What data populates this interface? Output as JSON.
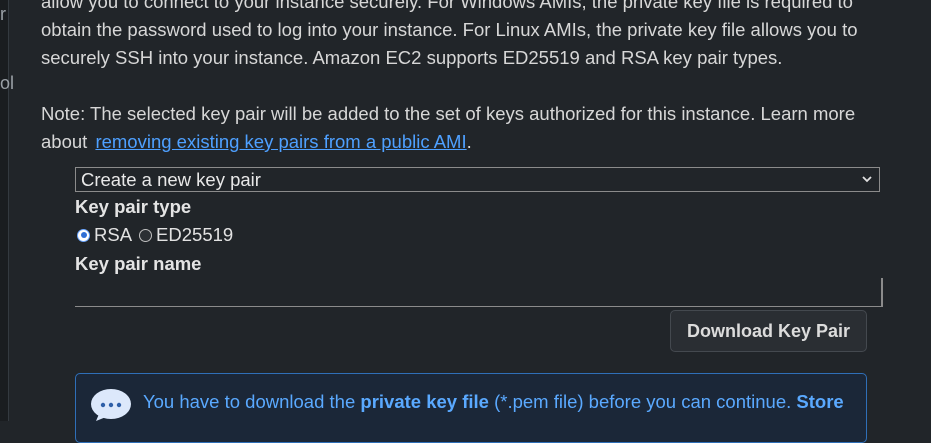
{
  "left_rail": {
    "fragments": [
      "r",
      "ol"
    ]
  },
  "intro": {
    "line1": "allow you to connect to your instance securely. For Windows AMIs, the private key file is required to",
    "line2": "obtain the password used to log into your instance. For Linux AMIs, the private key file allows you to",
    "line3": "securely SSH into your instance. Amazon EC2 supports ED25519 and RSA key pair types."
  },
  "note": {
    "line1": "Note: The selected key pair will be added to the set of keys authorized for this instance. Learn more",
    "prefix": "about",
    "link_text": "removing existing key pairs from a public AMI",
    "suffix": "."
  },
  "key_pair_select": {
    "value": "Create a new key pair",
    "chevron_icon": "chevron-down-icon"
  },
  "key_pair_type": {
    "label": "Key pair type",
    "options": [
      {
        "label": "RSA",
        "selected": true
      },
      {
        "label": "ED25519",
        "selected": false
      }
    ]
  },
  "key_pair_name": {
    "label": "Key pair name",
    "value": ""
  },
  "download_button": {
    "label": "Download Key Pair"
  },
  "alert": {
    "icon": "speech-bubble-dots-icon",
    "text_pre": "You have to download the ",
    "text_bold1": "private key file",
    "text_mid": " (*.pem file) before you can continue. ",
    "text_bold2": "Store"
  },
  "colors": {
    "background": "#212529",
    "link": "#4ea0ff",
    "alert_text": "#5aa9ff",
    "alert_border": "#2f6fb8"
  }
}
